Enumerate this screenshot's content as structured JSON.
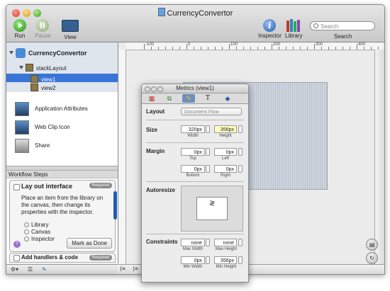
{
  "window": {
    "title": "CurrencyConvertor"
  },
  "toolbar": {
    "run_label": "Run",
    "pause_label": "Pause",
    "view_label": "View",
    "inspector_label": "Inspector",
    "library_label": "Library",
    "search_placeholder": "Search",
    "search_label": "Search"
  },
  "outline": {
    "root": "CurrencyConvertor",
    "layout": "stackLayout",
    "items": [
      "view1",
      "view2"
    ]
  },
  "attributes": [
    {
      "label": "Application Attributes"
    },
    {
      "label": "Web Clip Icon"
    },
    {
      "label": "Share"
    }
  ],
  "workflow": {
    "header": "Workflow Steps",
    "step1_title": "Lay out interface",
    "step1_badge": "Required",
    "step1_text": "Place an item from the library on the canvas, then change its properties with the inspector.",
    "options": [
      "Library",
      "Canvas",
      "Inspector"
    ],
    "done_button": "Mark as Done",
    "help": "?",
    "step2_title": "Add handlers & code",
    "step2_badge": "Required"
  },
  "ruler": {
    "labels": [
      "-100",
      "0",
      "100",
      "200",
      "300",
      "400"
    ]
  },
  "inspector": {
    "title": "Metrics (view1)",
    "layout_label": "Layout",
    "layout_value": "Document Flow",
    "size_label": "Size",
    "width_value": "320px",
    "height_value": "356px",
    "width_label": "Width",
    "height_label": "Height",
    "margin_label": "Margin",
    "top_value": "0px",
    "left_value": "0px",
    "bottom_value": "0px",
    "right_value": "0px",
    "top_label": "Top",
    "left_label": "Left",
    "bottom_label": "Bottom",
    "right_label": "Right",
    "autoresize_label": "Autoresize",
    "constraints_label": "Constraints",
    "max_width_value": "none",
    "max_height_value": "none",
    "min_width_value": "0px",
    "min_height_value": "356px",
    "max_width_label": "Max Width",
    "max_height_label": "Max Height",
    "min_width_label": "Min Width",
    "min_height_label": "Min Height"
  }
}
